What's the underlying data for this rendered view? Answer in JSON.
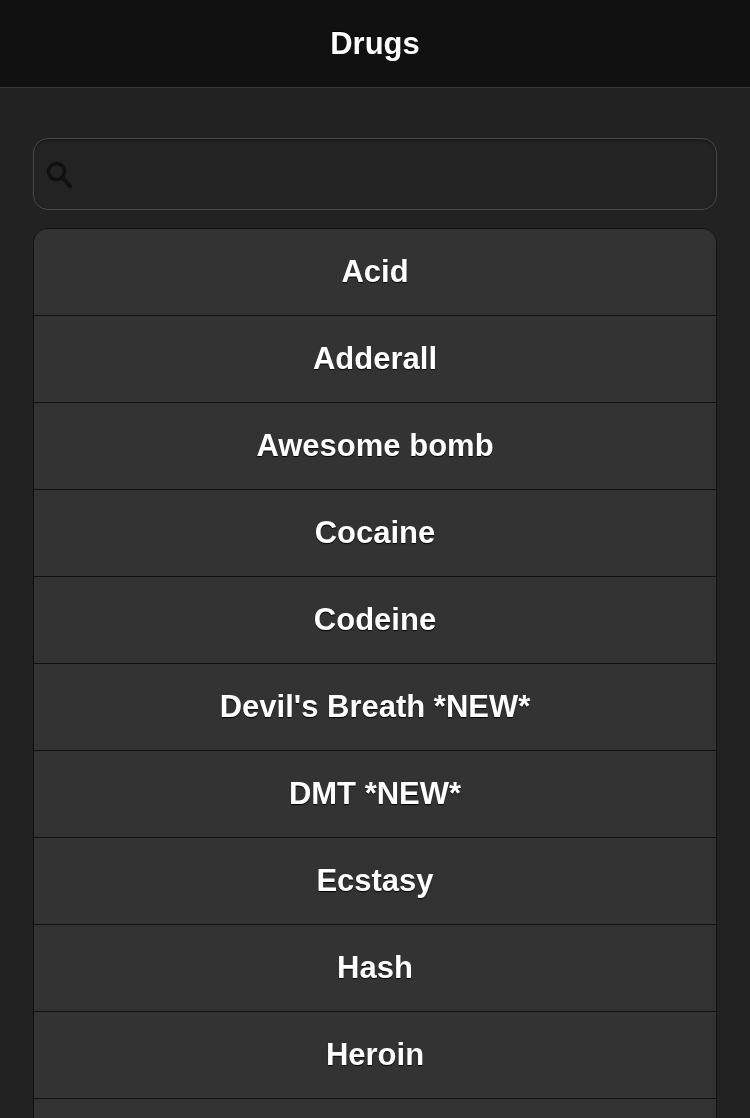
{
  "header": {
    "title": "Drugs"
  },
  "list": {
    "items": [
      {
        "label": "Acid"
      },
      {
        "label": "Adderall"
      },
      {
        "label": "Awesome bomb"
      },
      {
        "label": "Cocaine"
      },
      {
        "label": "Codeine"
      },
      {
        "label": "Devil's Breath *NEW*"
      },
      {
        "label": "DMT *NEW*"
      },
      {
        "label": "Ecstasy"
      },
      {
        "label": "Hash"
      },
      {
        "label": "Heroin"
      }
    ]
  }
}
